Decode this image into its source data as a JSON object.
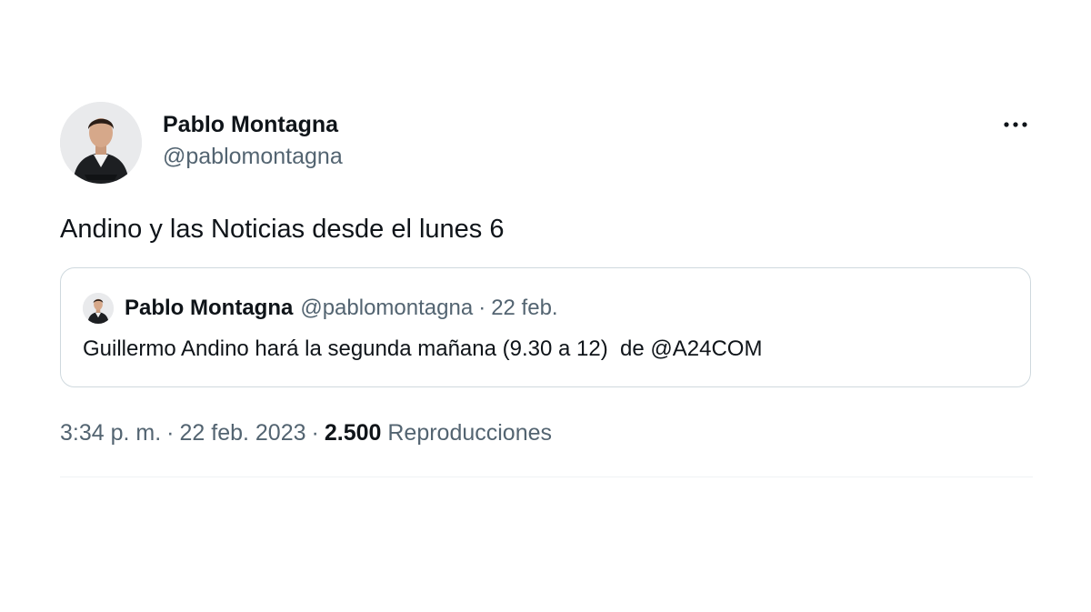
{
  "tweet": {
    "author": {
      "display_name": "Pablo Montagna",
      "handle": "@pablomontagna",
      "avatar": "avatar-photo"
    },
    "more_icon": "more-horizontal-icon",
    "text": "Andino y las Noticias desde el lunes 6",
    "quoted": {
      "display_name": "Pablo Montagna",
      "handle": "@pablomontagna",
      "separator": "·",
      "date": "22 feb.",
      "text": "Guillermo Andino hará la segunda mañana (9.30 a 12)  de @A24COM"
    },
    "meta": {
      "time": "3:34 p. m.",
      "separator": "·",
      "date": "22 feb. 2023",
      "views_count": "2.500",
      "views_label": "Reproducciones"
    }
  },
  "colors": {
    "text_primary": "#0f1419",
    "text_secondary": "#536471",
    "border": "#cfd9de",
    "divider": "#eff3f4"
  }
}
